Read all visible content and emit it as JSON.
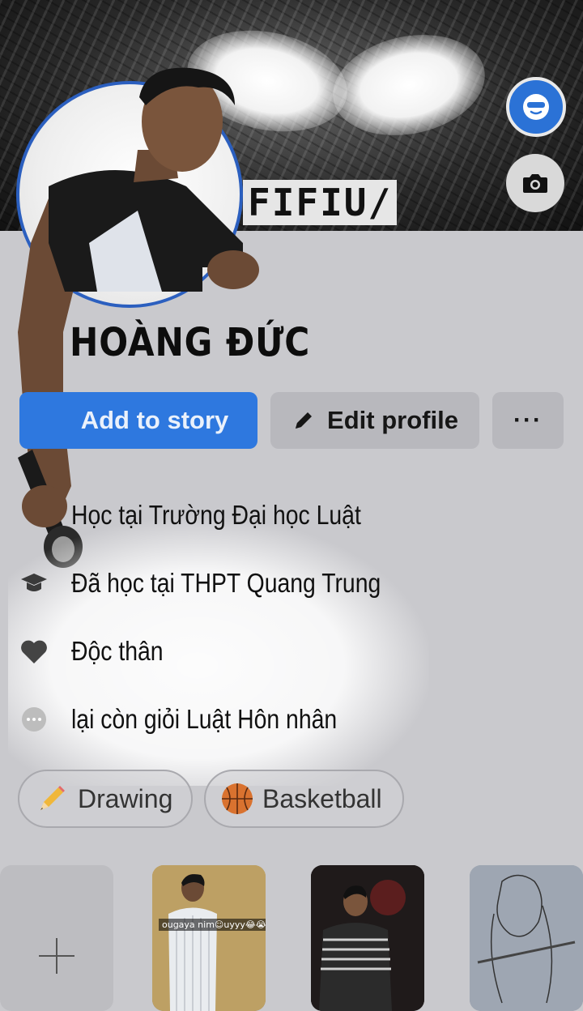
{
  "profile": {
    "name": "HOÀNG ĐỨC"
  },
  "cover": {
    "text": "FIFIU/"
  },
  "actions": {
    "add_story_label": "Add to story",
    "edit_profile_label": "Edit profile",
    "more_label": "···"
  },
  "details": [
    {
      "icon": "school-icon",
      "text": "Học tại Trường Đại học Luật"
    },
    {
      "icon": "graduation-cap-icon",
      "text": "Đã học tại THPT Quang Trung"
    },
    {
      "icon": "heart-icon",
      "text": "Độc thân"
    },
    {
      "icon": "more-dots-icon",
      "text": "lại còn giỏi Luật Hôn nhân"
    }
  ],
  "hobbies": [
    {
      "icon": "pencil-icon",
      "label": "Drawing"
    },
    {
      "icon": "basketball-icon",
      "label": "Basketball"
    }
  ],
  "featured": {
    "tile1_caption": "ougaya nim☺uyyy😂😭✌"
  },
  "colors": {
    "primary": "#2e78df",
    "secondary_button": "#b8b8bd",
    "background": "#c9c9cd",
    "profile_ring": "#2b5fbf"
  }
}
